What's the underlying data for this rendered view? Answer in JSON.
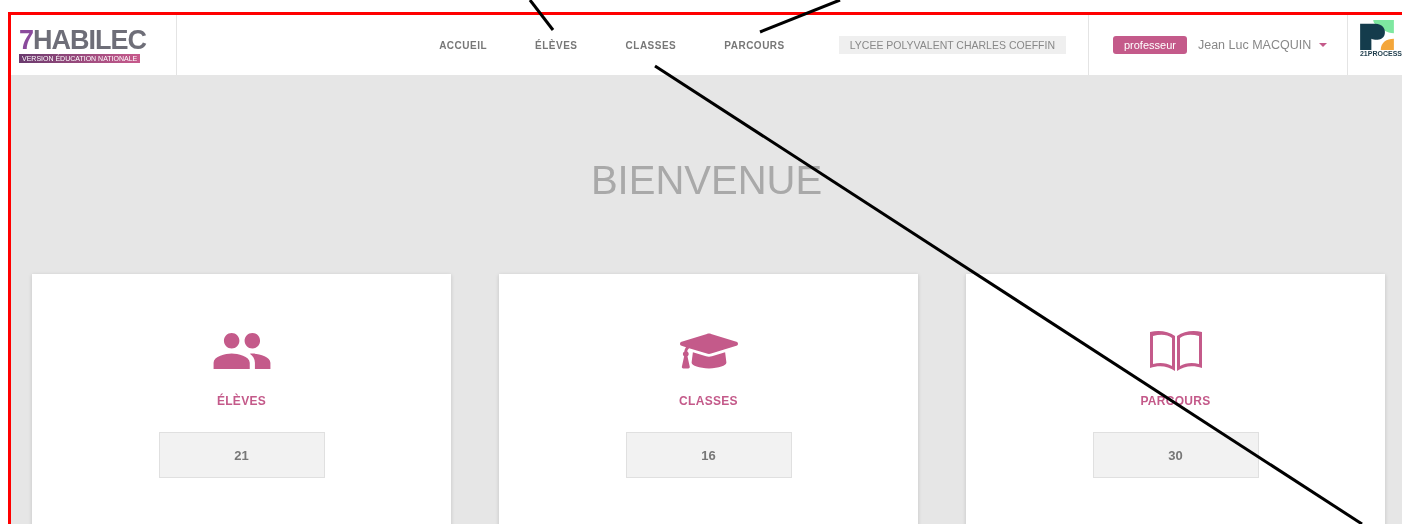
{
  "header": {
    "logo": {
      "mark": "7",
      "word": "HABILEC",
      "tagline": "VERSION ÉDUCATION NATIONALE"
    },
    "nav": [
      {
        "label": "ACCUEIL",
        "selected": false
      },
      {
        "label": "ÉLÈVES",
        "selected": false
      },
      {
        "label": "CLASSES",
        "selected": false
      },
      {
        "label": "PARCOURS",
        "selected": false
      }
    ],
    "school": "LYCEE POLYVALENT CHARLES COEFFIN",
    "role": "professeur",
    "user": "Jean Luc MACQUIN",
    "partner": "21PROCESS"
  },
  "title": "BIENVENUE",
  "cards": [
    {
      "kind": "students",
      "label": "ÉLÈVES",
      "count": "21"
    },
    {
      "kind": "classes",
      "label": "CLASSES",
      "count": "16"
    },
    {
      "kind": "paths",
      "label": "PARCOURS",
      "count": "30"
    }
  ]
}
